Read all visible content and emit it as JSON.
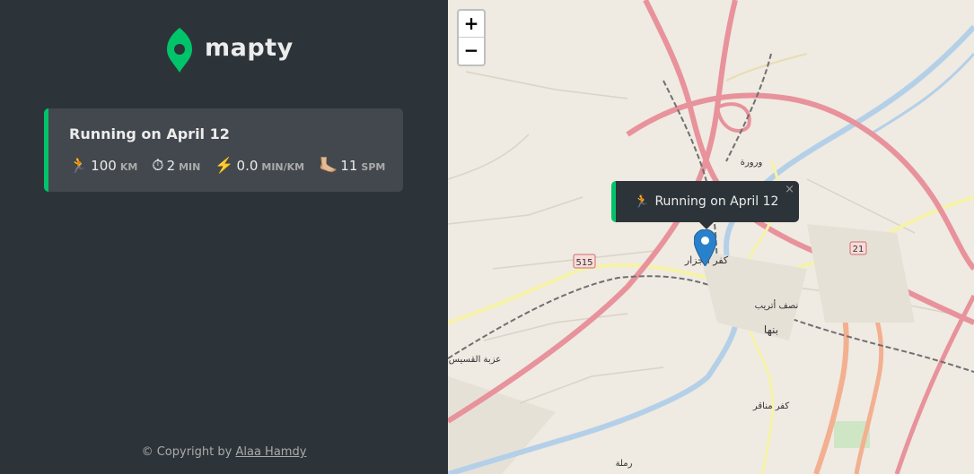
{
  "app": {
    "name": "mapty"
  },
  "workout": {
    "title": "Running on April 12",
    "details": [
      {
        "icon": "🏃",
        "value": "100",
        "unit": "km"
      },
      {
        "icon": "⏱",
        "value": "2",
        "unit": "min"
      },
      {
        "icon": "⚡️",
        "value": "0.0",
        "unit": "min/km"
      },
      {
        "icon": "🦶🏼",
        "value": "11",
        "unit": "spm"
      }
    ]
  },
  "footer": {
    "prefix": "© Copyright by ",
    "author": "Alaa Hamdy"
  },
  "map": {
    "zoom_in": "+",
    "zoom_out": "−",
    "popup": {
      "icon": "🏃",
      "text": "Running on April 12",
      "close": "×"
    },
    "labels": {
      "route_515": "515",
      "route_21": "21",
      "city": "بنها",
      "kafr": "كفر الجزار",
      "warwara": "ورورة",
      "nasf": "نصف أتريب",
      "izbat": "عزبة القسيس",
      "kafr_menaqer": "كفر مناقر",
      "ramla": "رملة"
    }
  },
  "colors": {
    "accent": "#00c46a",
    "sidebar_bg": "#2d3439",
    "card_bg": "#42484d"
  }
}
